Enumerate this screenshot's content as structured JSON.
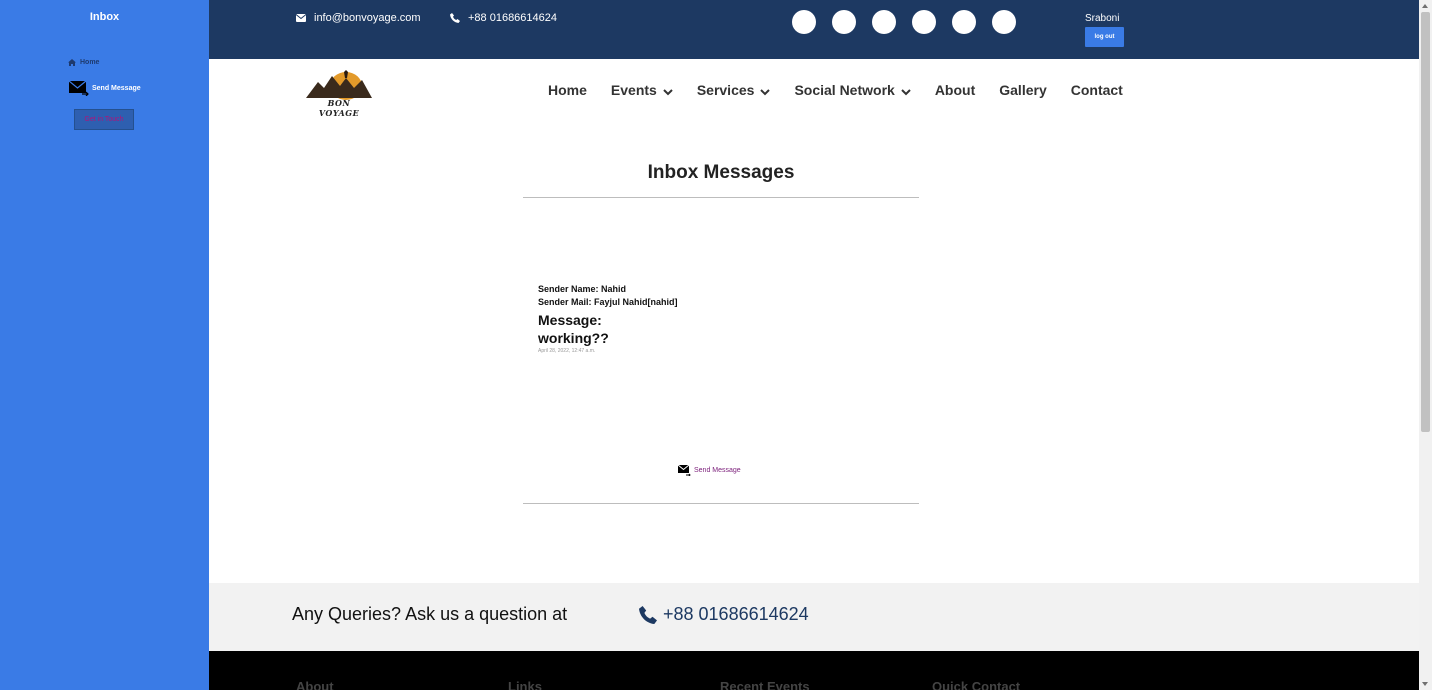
{
  "sidebar": {
    "title": "Inbox",
    "home_label": "Home",
    "send_label": "Send Message",
    "button_label": "Get in Touch"
  },
  "topbar": {
    "email": "info@bonvoyage.com",
    "phone": "+88 01686614624",
    "social_count": 6,
    "user_name": "Sraboni",
    "logout_label": "log out"
  },
  "nav": {
    "logo_text": "BON VOYAGE",
    "items": [
      {
        "label": "Home",
        "dropdown": false
      },
      {
        "label": "Events",
        "dropdown": true
      },
      {
        "label": "Services",
        "dropdown": true
      },
      {
        "label": "Social Network",
        "dropdown": true
      },
      {
        "label": "About",
        "dropdown": false
      },
      {
        "label": "Gallery",
        "dropdown": false
      },
      {
        "label": "Contact",
        "dropdown": false
      }
    ]
  },
  "main": {
    "title": "Inbox Messages",
    "message": {
      "sender_name": "Sender Name: Nahid",
      "sender_mail": "Sender Mail: Fayjul Nahid[nahid]",
      "label": "Message:",
      "body": "working??",
      "date": "April 28, 2022, 12:47 a.m."
    },
    "send_link": "Send Message"
  },
  "query": {
    "text": "Any Queries? Ask us a question at",
    "phone": "+88 01686614624"
  },
  "footer": {
    "headings": [
      "About",
      "Links",
      "Recent Events",
      "Quick Contact"
    ]
  },
  "colors": {
    "sidebar": "#3a7be6",
    "topbar": "#1d3962",
    "footer": "#000000"
  }
}
